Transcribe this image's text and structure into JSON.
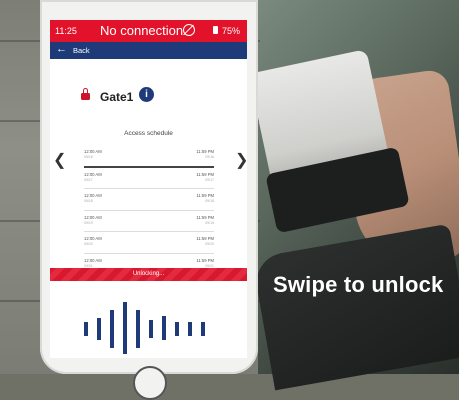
{
  "status_bar": {
    "time": "11:25",
    "connection": "No connection",
    "battery": "75%",
    "color": "#e3122b"
  },
  "nav": {
    "back_label": "Back",
    "back_icon": "arrow-left-icon",
    "color": "#1f3a78"
  },
  "gate": {
    "name": "Gate1",
    "info": "i"
  },
  "schedule": {
    "title": "Access schedule",
    "rows": [
      {
        "start": "12:00 AM",
        "end": "11:59 PM",
        "start_date": "09/16",
        "end_date": "09/16"
      },
      {
        "start": "12:00 AM",
        "end": "11:59 PM",
        "start_date": "09/17",
        "end_date": "09/17"
      },
      {
        "start": "12:00 AM",
        "end": "11:59 PM",
        "start_date": "09/18",
        "end_date": "09/18"
      },
      {
        "start": "12:00 AM",
        "end": "11:59 PM",
        "start_date": "09/19",
        "end_date": "09/19"
      },
      {
        "start": "12:00 AM",
        "end": "11:59 PM",
        "start_date": "09/20",
        "end_date": "09/20"
      },
      {
        "start": "12:00 AM",
        "end": "11:59 PM",
        "start_date": "09/21",
        "end_date": "09/21"
      }
    ]
  },
  "unlock": {
    "label": "Unlocking..."
  },
  "caption": "Swipe to unlock"
}
